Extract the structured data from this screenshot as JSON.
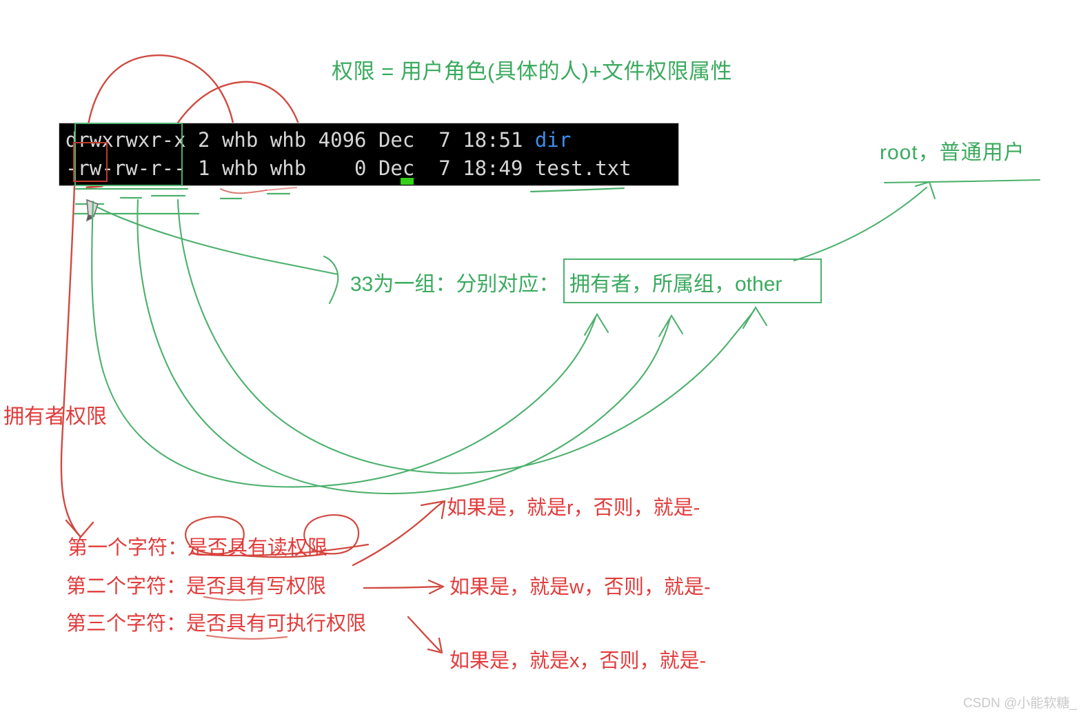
{
  "page": {
    "title_note": "权限 = 用户角色(具体的人)+文件权限属性",
    "watermark": "CSDN @小能软糖_"
  },
  "colors": {
    "green_ink": "#3aaa5e",
    "green_box": "#4cb06c",
    "red_ink": "#e23b3b",
    "red_box": "#c0392b",
    "terminal_bg": "#000000",
    "terminal_fg": "#d6d6d6",
    "terminal_dir_blue": "#3b8eea",
    "cursor_green": "#33d017",
    "watermark_gray": "#c9c9c9"
  },
  "terminal": {
    "lines": [
      {
        "permissions": "drwxrwxr-x",
        "links": "2",
        "owner": "whb",
        "group": "whb",
        "size": "4096",
        "month": "Dec",
        "day": "7",
        "time": "18:51",
        "name": "dir",
        "name_color": "blue",
        "raw": "drwxrwxr-x 2 whb whb 4096 Dec  7 18:51 "
      },
      {
        "permissions": "-rw-rw-r--",
        "links": "1",
        "owner": "whb",
        "group": "whb",
        "size": "0",
        "month": "Dec",
        "day": "7",
        "time": "18:49",
        "name": "test.txt",
        "name_color": "default",
        "raw": "-rw-rw-r-- 1 whb whb    0 Dec  7 18:49 test.txt"
      }
    ],
    "line1_prefix": "drwxrwxr-x 2 whb whb 4096 Dec  7 18:51 ",
    "line1_name": "dir",
    "line2_full": "-rw-rw-r-- 1 whb whb    0 Dec  7 18:49 test.txt"
  },
  "annotations": {
    "green": {
      "role_users": "root，普通用户",
      "group_label": "33为一组：分别对应：",
      "group_box": "拥有者，所属组，other"
    },
    "red": {
      "owner_permission": "拥有者权限",
      "char_rules": [
        "第一个字符：是否具有读权限",
        "第二个字符：是否具有写权限",
        "第三个字符：是否具有可执行权限"
      ],
      "results": [
        "如果是，就是r，否则，就是-",
        "如果是，就是w，否则，就是-",
        "如果是，就是x，否则，就是-"
      ]
    }
  },
  "icons": {
    "pencil": "pencil-icon",
    "cursor": "terminal-cursor-block"
  }
}
